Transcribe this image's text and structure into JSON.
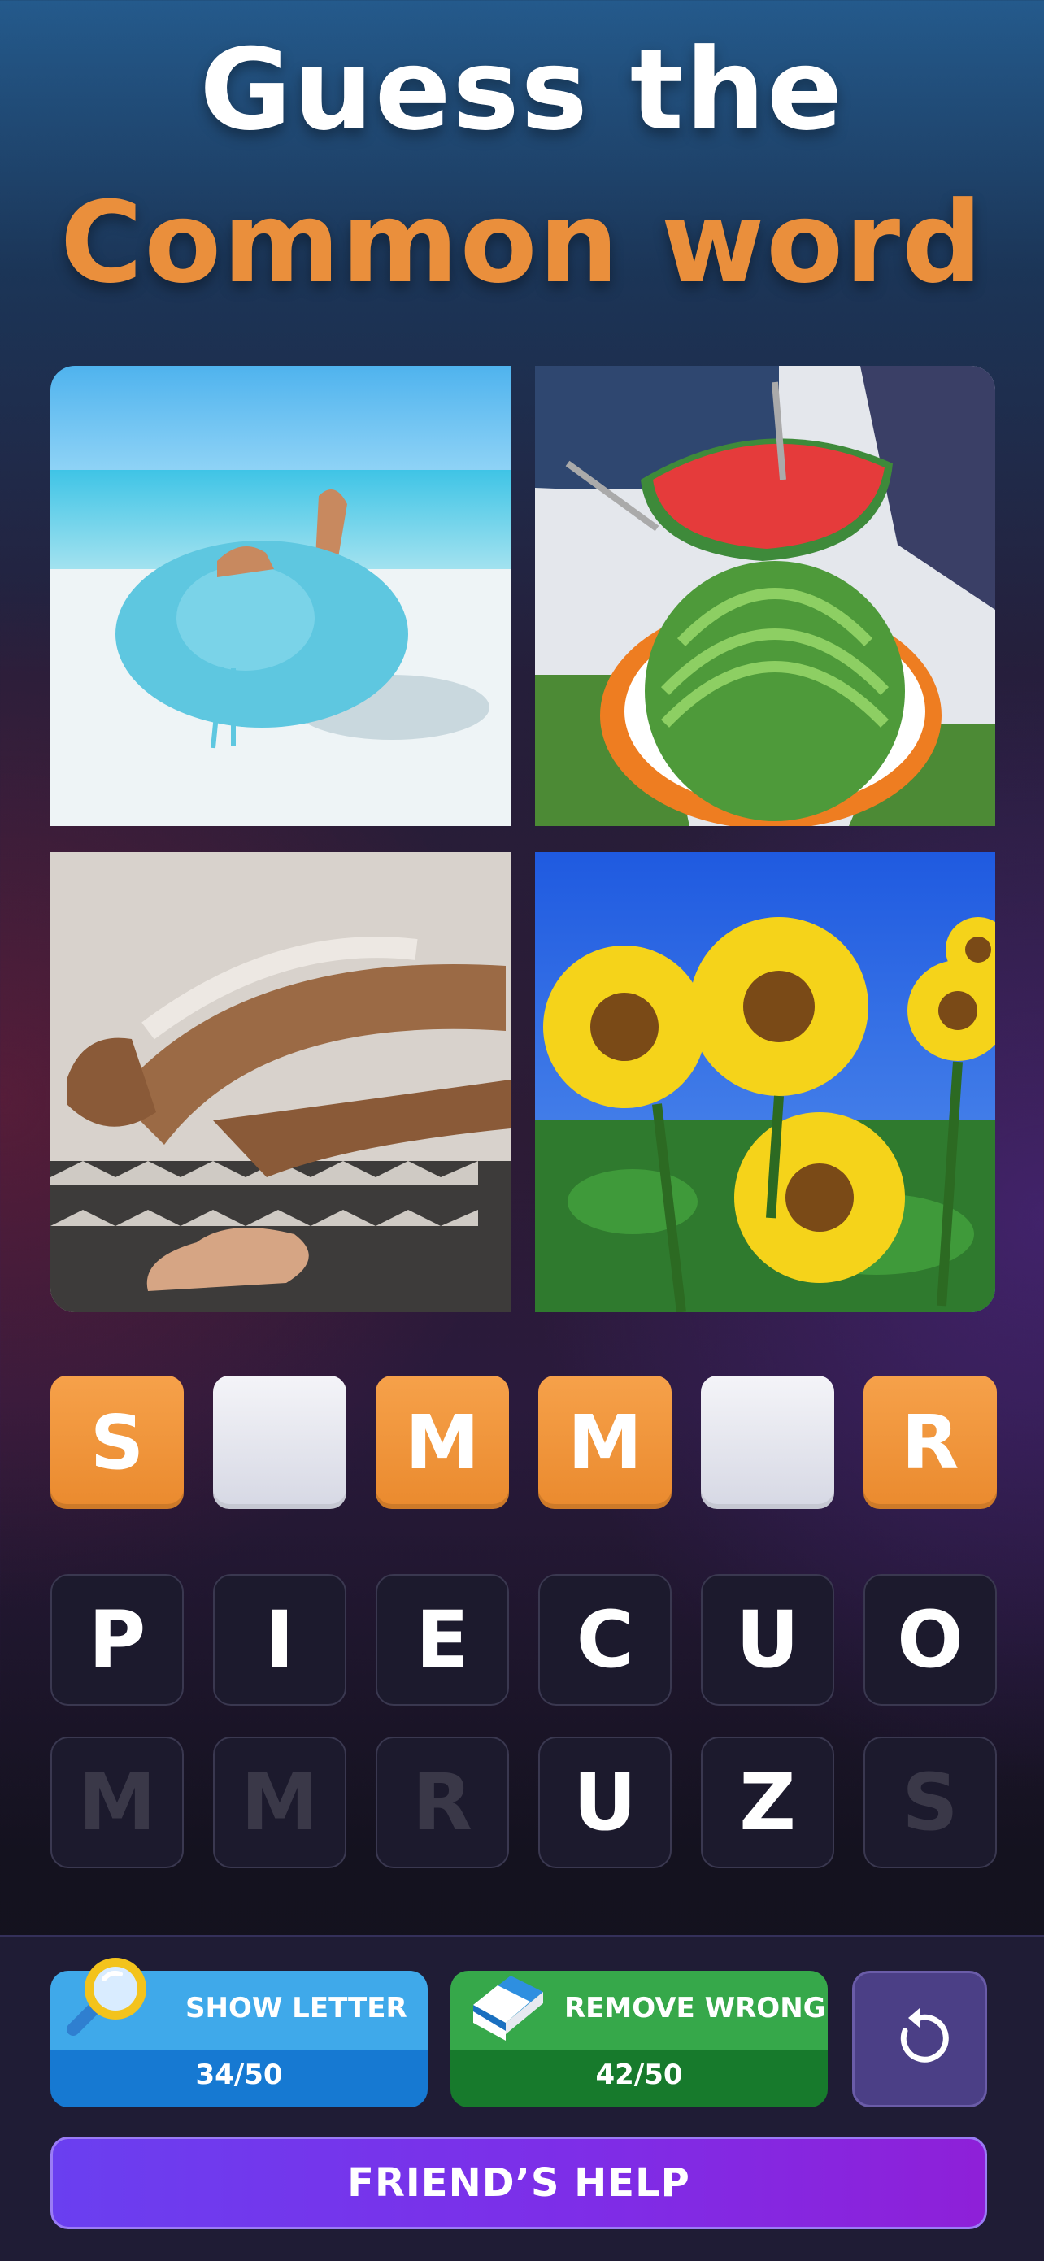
{
  "header": {
    "line1": "Guess the",
    "line2": "Common word",
    "accent_color": "#ea8f3c"
  },
  "photos": [
    {
      "subject": "woman-in-sun-hat-on-beach"
    },
    {
      "subject": "watermelon-picnic"
    },
    {
      "subject": "sunscreen-on-legs"
    },
    {
      "subject": "sunflowers"
    }
  ],
  "answer_slots": [
    "S",
    "",
    "M",
    "M",
    "",
    "R"
  ],
  "letter_keys_row1": [
    "P",
    "I",
    "E",
    "C",
    "U",
    "O"
  ],
  "letter_keys_row2": [
    "M",
    "M",
    "R",
    "U",
    "Z",
    "S"
  ],
  "used_keys_row2": [
    true,
    true,
    true,
    false,
    false,
    true
  ],
  "powerups": {
    "show_letter": {
      "label": "SHOW LETTER",
      "count": "34/50",
      "icon": "magnifier-icon"
    },
    "remove_wrong": {
      "label": "REMOVE WRONG",
      "count": "42/50",
      "icon": "eraser-icon"
    },
    "reset": {
      "icon": "reset-icon"
    }
  },
  "friends_help_label": "FRIEND’S HELP"
}
